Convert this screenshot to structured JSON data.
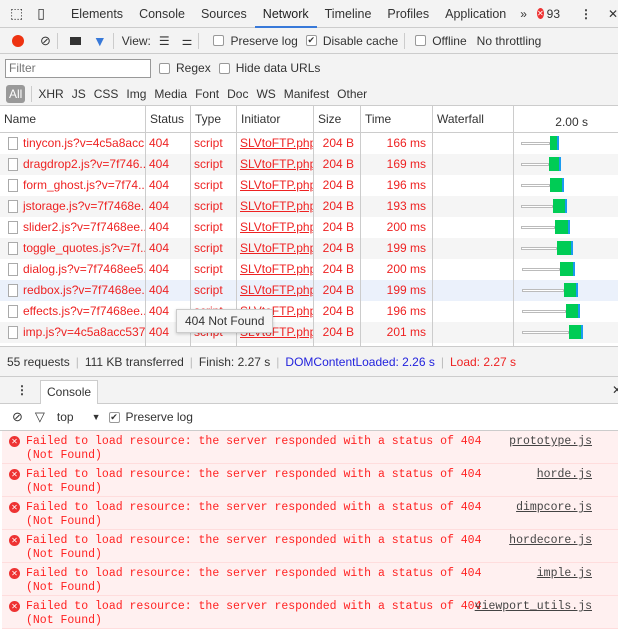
{
  "tabs": {
    "items": [
      "Elements",
      "Console",
      "Sources",
      "Network",
      "Timeline",
      "Profiles",
      "Application"
    ],
    "active": "Network",
    "more": "»",
    "error_count": "93"
  },
  "toolbar": {
    "view_label": "View:",
    "preserve_log": "Preserve log",
    "preserve_log_checked": false,
    "disable_cache": "Disable cache",
    "disable_cache_checked": true,
    "offline": "Offline",
    "throttling": "No throttling"
  },
  "filter": {
    "placeholder": "Filter",
    "regex": "Regex",
    "hide_data_urls": "Hide data URLs"
  },
  "types": [
    "All",
    "XHR",
    "JS",
    "CSS",
    "Img",
    "Media",
    "Font",
    "Doc",
    "WS",
    "Manifest",
    "Other"
  ],
  "columns": [
    "Name",
    "Status",
    "Type",
    "Initiator",
    "Size",
    "Time",
    "Waterfall",
    "2.00 s"
  ],
  "rows": [
    {
      "name": "tinycon.js?v=4c5a8acc...",
      "status": "404",
      "type": "script",
      "initiator": "SLVtoFTP.php",
      "size": "204 B",
      "time": "166 ms"
    },
    {
      "name": "dragdrop2.js?v=7f746...",
      "status": "404",
      "type": "script",
      "initiator": "SLVtoFTP.php",
      "size": "204 B",
      "time": "169 ms"
    },
    {
      "name": "form_ghost.js?v=7f74...",
      "status": "404",
      "type": "script",
      "initiator": "SLVtoFTP.php",
      "size": "204 B",
      "time": "196 ms"
    },
    {
      "name": "jstorage.js?v=7f7468e...",
      "status": "404",
      "type": "script",
      "initiator": "SLVtoFTP.php",
      "size": "204 B",
      "time": "193 ms"
    },
    {
      "name": "slider2.js?v=7f7468ee...",
      "status": "404",
      "type": "script",
      "initiator": "SLVtoFTP.php",
      "size": "204 B",
      "time": "200 ms"
    },
    {
      "name": "toggle_quotes.js?v=7f...",
      "status": "404",
      "type": "script",
      "initiator": "SLVtoFTP.php",
      "size": "204 B",
      "time": "199 ms"
    },
    {
      "name": "dialog.js?v=7f7468ee5...",
      "status": "404",
      "type": "script",
      "initiator": "SLVtoFTP.php",
      "size": "204 B",
      "time": "200 ms"
    },
    {
      "name": "redbox.js?v=7f7468ee...",
      "status": "404",
      "type": "script",
      "initiator": "SLVtoFTP.php",
      "size": "204 B",
      "time": "199 ms"
    },
    {
      "name": "effects.js?v=7f7468ee...",
      "status": "404",
      "type": "script",
      "initiator": "SLVtoFTP.php",
      "size": "204 B",
      "time": "196 ms"
    },
    {
      "name": "imp.js?v=4c5a8acc537...",
      "status": "404",
      "type": "script",
      "initiator": "SLVtoFTP.php",
      "size": "204 B",
      "time": "201 ms"
    }
  ],
  "tooltip": "404 Not Found",
  "summary": {
    "requests": "55 requests",
    "transferred": "111 KB transferred",
    "finish": "Finish: 2.27 s",
    "dcl": "DOMContentLoaded: 2.26 s",
    "load": "Load: 2.27 s"
  },
  "drawer": {
    "tab": "Console"
  },
  "console_toolbar": {
    "context": "top",
    "preserve_log": "Preserve log",
    "preserve_log_checked": true
  },
  "messages": [
    {
      "text": "Failed to load resource: the server responded with a status of 404 (Not Found)",
      "source": "prototype.js"
    },
    {
      "text": "Failed to load resource: the server responded with a status of 404 (Not Found)",
      "source": "horde.js"
    },
    {
      "text": "Failed to load resource: the server responded with a status of 404 (Not Found)",
      "source": "dimpcore.js"
    },
    {
      "text": "Failed to load resource: the server responded with a status of 404 (Not Found)",
      "source": "hordecore.js"
    },
    {
      "text": "Failed to load resource: the server responded with a status of 404 (Not Found)",
      "source": "imple.js"
    },
    {
      "text": "Failed to load resource: the server responded with a status of 404 (Not Found)",
      "source": "viewport_utils.js"
    }
  ],
  "colors": {
    "accent": "#3879d9",
    "error": "#e22222",
    "record": "#e31",
    "waterfall_receive": "#00cc55",
    "dcl": "#2222dd"
  }
}
